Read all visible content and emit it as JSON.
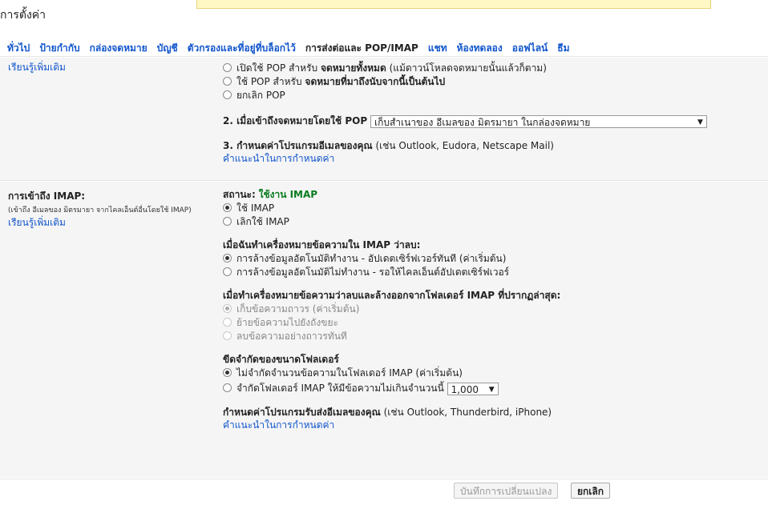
{
  "page": {
    "title": "การตั้งค่า"
  },
  "tabs": [
    {
      "label": "ทั่วไป"
    },
    {
      "label": "ป้ายกำกับ"
    },
    {
      "label": "กล่องจดหมาย"
    },
    {
      "label": "บัญชี"
    },
    {
      "label": "ตัวกรองและที่อยู่ที่บล็อกไว้"
    },
    {
      "label": "การส่งต่อและ POP/IMAP"
    },
    {
      "label": "แชท"
    },
    {
      "label": "ห้องทดลอง"
    },
    {
      "label": "ออฟไลน์"
    },
    {
      "label": "ธีม"
    }
  ],
  "pop": {
    "learn_more": "เรียนรู้เพิ่มเติม",
    "opt_all_prefix": "เปิดใช้ POP สำหรับ",
    "opt_all_bold": "จดหมายทั้งหมด",
    "opt_all_suffix": "(แม้ดาวน์โหลดจดหมายนั้นแล้วก็ตาม)",
    "opt_from_now_prefix": "ใช้ POP สำหรับ",
    "opt_from_now_bold": "จดหมายที่มาถึงนับจากนี้เป็นต้นไป",
    "opt_disable": "ยกเลิก POP",
    "access_label": "2. เมื่อเข้าถึงจดหมายโดยใช้ POP",
    "access_select": "เก็บสำเนาของ อีเมลของ มิตรมายา ในกล่องจดหมาย",
    "client_label": "3. กำหนดค่าโปรแกรมอีเมลของคุณ",
    "client_examples": "(เช่น Outlook, Eudora, Netscape Mail)",
    "client_link": "คำแนะนำในการกำหนดค่า"
  },
  "imap": {
    "heading": "การเข้าถึง IMAP:",
    "subheading": "(เข้าถึง อีเมลของ มิตรมายา จากไคลเอ็นต์อื่นโดยใช้ IMAP)",
    "learn_more": "เรียนรู้เพิ่มเติม",
    "status_label": "สถานะ:",
    "status_value": "ใช้งาน IMAP",
    "opt_enable": "ใช้ IMAP",
    "opt_disable": "เลิกใช้ IMAP",
    "delete_heading": "เมื่อฉันทำเครื่องหมายข้อความใน IMAP ว่าลบ:",
    "delete_opt_on": "การล้างข้อมูลอัตโนมัติทำงาน - อัปเดตเซิร์ฟเวอร์ทันที (ค่าเริ่มต้น)",
    "delete_opt_off": "การล้างข้อมูลอัตโนมัติไม่ทำงาน - รอให้ไคลเอ็นต์อัปเดตเซิร์ฟเวอร์",
    "expunge_heading": "เมื่อทำเครื่องหมายข้อความว่าลบและล้างออกจากโฟลเดอร์ IMAP ที่ปรากฏล่าสุด:",
    "expunge_archive": "เก็บข้อความถาวร (ค่าเริ่มต้น)",
    "expunge_trash": "ย้ายข้อความไปยังถังขยะ",
    "expunge_delete": "ลบข้อความอย่างถาวรทันที",
    "folder_heading": "ขีดจำกัดของขนาดโฟลเดอร์",
    "folder_no_limit": "ไม่จำกัดจำนวนข้อความในโฟลเดอร์ IMAP (ค่าเริ่มต้น)",
    "folder_limit": "จำกัดโฟลเดอร์ IMAP ให้มีข้อความไม่เกินจำนวนนี้",
    "folder_limit_value": "1,000",
    "client_label": "กำหนดค่าโปรแกรมรับส่งอีเมลของคุณ",
    "client_examples": "(เช่น Outlook, Thunderbird, iPhone)",
    "client_link": "คำแนะนำในการกำหนดค่า"
  },
  "footer": {
    "save": "บันทึกการเปลี่ยนแปลง",
    "cancel": "ยกเลิก"
  },
  "colors": {
    "link": "#1155cc",
    "status_green": "#0a7b20",
    "panel_bg": "#f5f5f5",
    "notice_bg": "#fff8c4"
  }
}
